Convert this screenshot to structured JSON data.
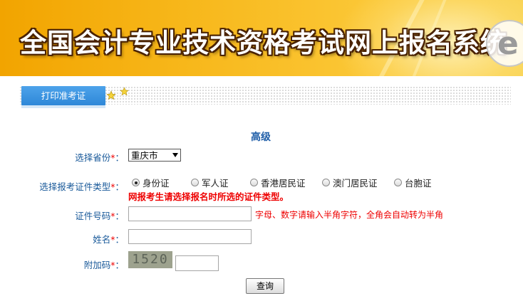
{
  "banner": {
    "title": "全国会计专业技术资格考试网上报名系统"
  },
  "tab": {
    "label": "打印准考证"
  },
  "form": {
    "heading": "高级",
    "province_label": "选择省份",
    "province_value": "重庆市",
    "idtype_label": "选择报考证件类型",
    "id_types": [
      "身份证",
      "军人证",
      "香港居民证",
      "澳门居民证",
      "台胞证"
    ],
    "selected_id_type": "身份证",
    "warning": "网报考生请选择报名时所选的证件类型。",
    "idnum_label": "证件号码",
    "idnum_value": "",
    "idnum_hint": "字母、数字请输入半角字符，全角会自动转为半角",
    "name_label": "姓名",
    "name_value": "",
    "captcha_label": "附加码",
    "captcha_text": "1520",
    "captcha_value": "",
    "required_mark": "*",
    "colon": "：",
    "submit_label": "查询"
  }
}
